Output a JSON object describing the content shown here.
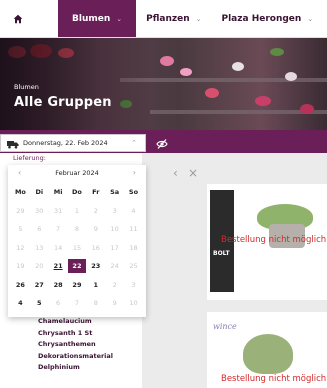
{
  "nav": {
    "items": [
      {
        "label": "Blumen",
        "active": true
      },
      {
        "label": "Pflanzen",
        "active": false
      },
      {
        "label": "Plaza Herongen",
        "active": false
      }
    ]
  },
  "header": {
    "breadcrumb": "Blumen",
    "title": "Alle Gruppen"
  },
  "delivery": {
    "date": "Donnerstag, 22. Feb 2024",
    "label": "Lieferung:"
  },
  "calendar": {
    "month": "Februar 2024",
    "weekdays": [
      "Mo",
      "Di",
      "Mi",
      "Do",
      "Fr",
      "Sa",
      "So"
    ],
    "weeks": [
      [
        {
          "d": "29",
          "a": false
        },
        {
          "d": "30",
          "a": false
        },
        {
          "d": "31",
          "a": false
        },
        {
          "d": "1",
          "a": false
        },
        {
          "d": "2",
          "a": false
        },
        {
          "d": "3",
          "a": false
        },
        {
          "d": "4",
          "a": false
        }
      ],
      [
        {
          "d": "5",
          "a": false
        },
        {
          "d": "6",
          "a": false
        },
        {
          "d": "7",
          "a": false
        },
        {
          "d": "8",
          "a": false
        },
        {
          "d": "9",
          "a": false
        },
        {
          "d": "10",
          "a": false
        },
        {
          "d": "11",
          "a": false
        }
      ],
      [
        {
          "d": "12",
          "a": false
        },
        {
          "d": "13",
          "a": false
        },
        {
          "d": "14",
          "a": false
        },
        {
          "d": "15",
          "a": false
        },
        {
          "d": "16",
          "a": false
        },
        {
          "d": "17",
          "a": false
        },
        {
          "d": "18",
          "a": false
        }
      ],
      [
        {
          "d": "19",
          "a": false
        },
        {
          "d": "20",
          "a": false
        },
        {
          "d": "21",
          "a": true,
          "today": true
        },
        {
          "d": "22",
          "a": true,
          "sel": true
        },
        {
          "d": "23",
          "a": true
        },
        {
          "d": "24",
          "a": false
        },
        {
          "d": "25",
          "a": false
        }
      ],
      [
        {
          "d": "26",
          "a": true
        },
        {
          "d": "27",
          "a": true
        },
        {
          "d": "28",
          "a": true
        },
        {
          "d": "29",
          "a": true
        },
        {
          "d": "1",
          "a": true
        },
        {
          "d": "2",
          "a": false
        },
        {
          "d": "3",
          "a": false
        }
      ],
      [
        {
          "d": "4",
          "a": true
        },
        {
          "d": "5",
          "a": true
        },
        {
          "d": "6",
          "a": false
        },
        {
          "d": "7",
          "a": false
        },
        {
          "d": "8",
          "a": false
        },
        {
          "d": "9",
          "a": false
        },
        {
          "d": "10",
          "a": false
        }
      ]
    ]
  },
  "categories": [
    "Chamelaucium",
    "Chrysanth 1 St",
    "Chrysanthemen",
    "Dekorationsmaterial",
    "Delphinium"
  ],
  "products": [
    {
      "brand": "BOLT",
      "status": "Bestellung nicht möglich"
    },
    {
      "brand": "wince",
      "status": "Bestellung nicht möglich"
    }
  ],
  "colors": {
    "brand": "#6b1f59",
    "error": "#d22a2a"
  }
}
